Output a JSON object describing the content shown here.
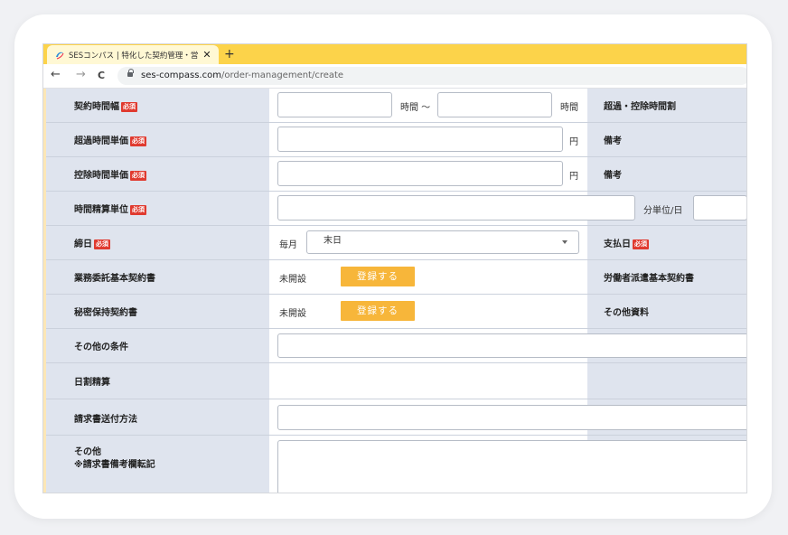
{
  "browser": {
    "tab_title": "SESコンパス | 特化した契約管理・営",
    "tab_close": "✕",
    "new_tab": "+",
    "back": "←",
    "forward": "→",
    "reload": "C",
    "url_host": "ses-compass.com",
    "url_path": "/order-management/create"
  },
  "form": {
    "required_badge": "必須",
    "contract_hours": {
      "label": "契約時間幅",
      "sep_text": "時間 〜",
      "unit": "時間",
      "right_label": "超過・控除時間割"
    },
    "overtime_rate": {
      "label": "超過時間単価",
      "unit": "円",
      "right_label": "備考"
    },
    "deduction_rate": {
      "label": "控除時間単価",
      "unit": "円",
      "right_label": "備考"
    },
    "time_unit": {
      "label": "時間精算単位",
      "unit": "分単位/日"
    },
    "closing_day": {
      "label": "締日",
      "prefix": "毎月",
      "selected": "末日",
      "right_label": "支払日"
    },
    "outsourcing_contract": {
      "label": "業務委託基本契約書",
      "status": "未開設",
      "button": "登録する",
      "right_label": "労働者派遣基本契約書"
    },
    "nda": {
      "label": "秘密保持契約書",
      "status": "未開設",
      "button": "登録する",
      "right_label": "その他資料"
    },
    "other_conditions": {
      "label": "その他の条件"
    },
    "daily_settlement": {
      "label": "日割精算"
    },
    "invoice_method": {
      "label": "請求書送付方法"
    },
    "other": {
      "label": "その他",
      "sub_label": "※請求書備考欄転記"
    }
  },
  "colors": {
    "tab_bar": "#fcd34a",
    "label_bg": "#dfe4ee",
    "button": "#f7b63a",
    "required": "#e03a2f"
  }
}
